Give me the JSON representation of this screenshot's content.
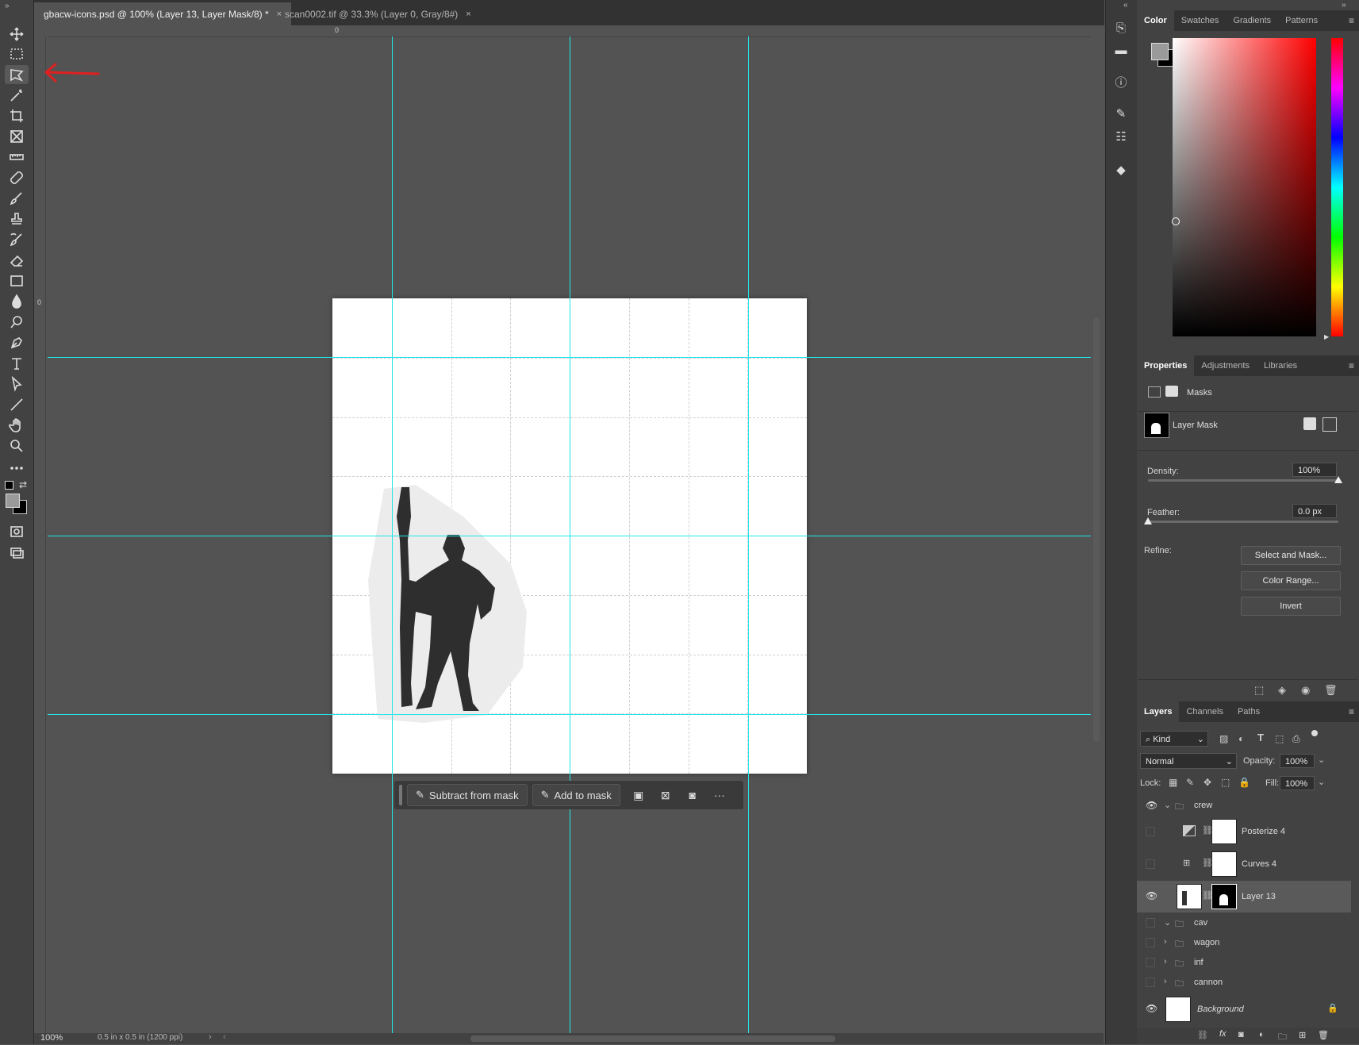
{
  "tabs": [
    {
      "label": "gbacw-icons.psd @ 100% (Layer 13, Layer Mask/8) *",
      "close": "×"
    },
    {
      "label": "scan0002.tif @ 33.3% (Layer 0, Gray/8#)",
      "close": "×"
    }
  ],
  "ruler": {
    "top_zero": "0",
    "left_zero": "0"
  },
  "task_bar": {
    "subtract_label": "Subtract from mask",
    "add_label": "Add to mask",
    "more": "···"
  },
  "status": {
    "zoom": "100%",
    "doc_info": "0.5 in x 0.5 in (1200 ppi)"
  },
  "color_panel": {
    "tabs": [
      "Color",
      "Swatches",
      "Gradients",
      "Patterns"
    ],
    "foreground": "#9a9a9a",
    "background": "#000000",
    "hue_base": "#ff0000"
  },
  "properties_panel": {
    "tabs": [
      "Properties",
      "Adjustments",
      "Libraries"
    ],
    "section": "Masks",
    "mask_label": "Layer Mask",
    "density_label": "Density:",
    "density_value": "100%",
    "density_level": 1.0,
    "feather_label": "Feather:",
    "feather_value": "0.0 px",
    "feather_level": 0.0,
    "refine_label": "Refine:",
    "select_and_mask": "Select and Mask...",
    "color_range": "Color Range...",
    "invert": "Invert"
  },
  "layers_panel": {
    "tabs": [
      "Layers",
      "Channels",
      "Paths"
    ],
    "filter_kind": "Kind",
    "blend_mode": "Normal",
    "opacity_label": "Opacity:",
    "opacity_value": "100%",
    "lock_label": "Lock:",
    "fill_label": "Fill:",
    "fill_value": "100%",
    "layers": [
      {
        "name": "crew",
        "type": "group",
        "visible": true,
        "expanded": true
      },
      {
        "name": "Posterize 4",
        "type": "adjustment",
        "visible": false
      },
      {
        "name": "Curves 4",
        "type": "adjustment",
        "visible": false
      },
      {
        "name": "Layer 13",
        "type": "pixel-with-mask",
        "visible": true,
        "selected": true
      },
      {
        "name": "cav",
        "type": "group",
        "visible": false,
        "expanded": true
      },
      {
        "name": "wagon",
        "type": "group",
        "visible": false
      },
      {
        "name": "inf",
        "type": "group",
        "visible": false
      },
      {
        "name": "cannon",
        "type": "group",
        "visible": false
      },
      {
        "name": "Background",
        "type": "background",
        "visible": true,
        "locked": true
      }
    ]
  },
  "annotations": {
    "color": "#e02020"
  }
}
